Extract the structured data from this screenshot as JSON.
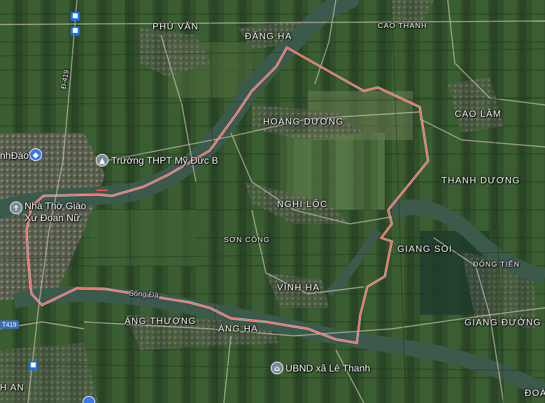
{
  "map": {
    "type": "satellite",
    "colors": {
      "terrain": "#2f4a2a",
      "fields_light": "#5c7a45",
      "fields_dark": "#22381f",
      "river": "#3c5a4c",
      "boundary": "#ff4a4a",
      "roads": "#c9c2b3"
    },
    "boundary_label": "",
    "places": {
      "phu_van": "PHÚ VĂN",
      "dang_ha": "ĐĂNG HẠ",
      "cao_thanh": "CAO THÀNH",
      "cao_lam": "CAO LÂM",
      "hoang_duong": "HOÀNG DƯƠNG",
      "thanh_duong": "THANH DƯƠNG",
      "nghi_loc": "NGHI LỘC",
      "son_cong": "SƠN CÔNG",
      "giang_soi": "GIANG SOI",
      "dong_tien": "ĐÔNG TIẾN",
      "vinh_ha": "VĨNH HẠ",
      "ang_thuong": "ÁNG THƯỢNG",
      "ang_ha": "ÁNG HẠ",
      "giang_duong": "GIANG ĐƯỜNG",
      "doa": "ĐOÀ",
      "h_an": "H AN"
    },
    "pois": {
      "school": "Trường THPT Mỹ Đức B",
      "church_line1": "Nhà Thờ Giáo",
      "church_line2": "Xứ Đoan Nữ",
      "ubnd": "UBND xã Lê Thanh",
      "nhdao": "nhĐào"
    },
    "river_label": "Sông Đà",
    "roads": {
      "d419": "Đ-419",
      "t419": "T419"
    },
    "icons": [
      "bus-stop-icon",
      "school-icon",
      "church-icon",
      "government-building-icon",
      "shopping-icon"
    ]
  }
}
